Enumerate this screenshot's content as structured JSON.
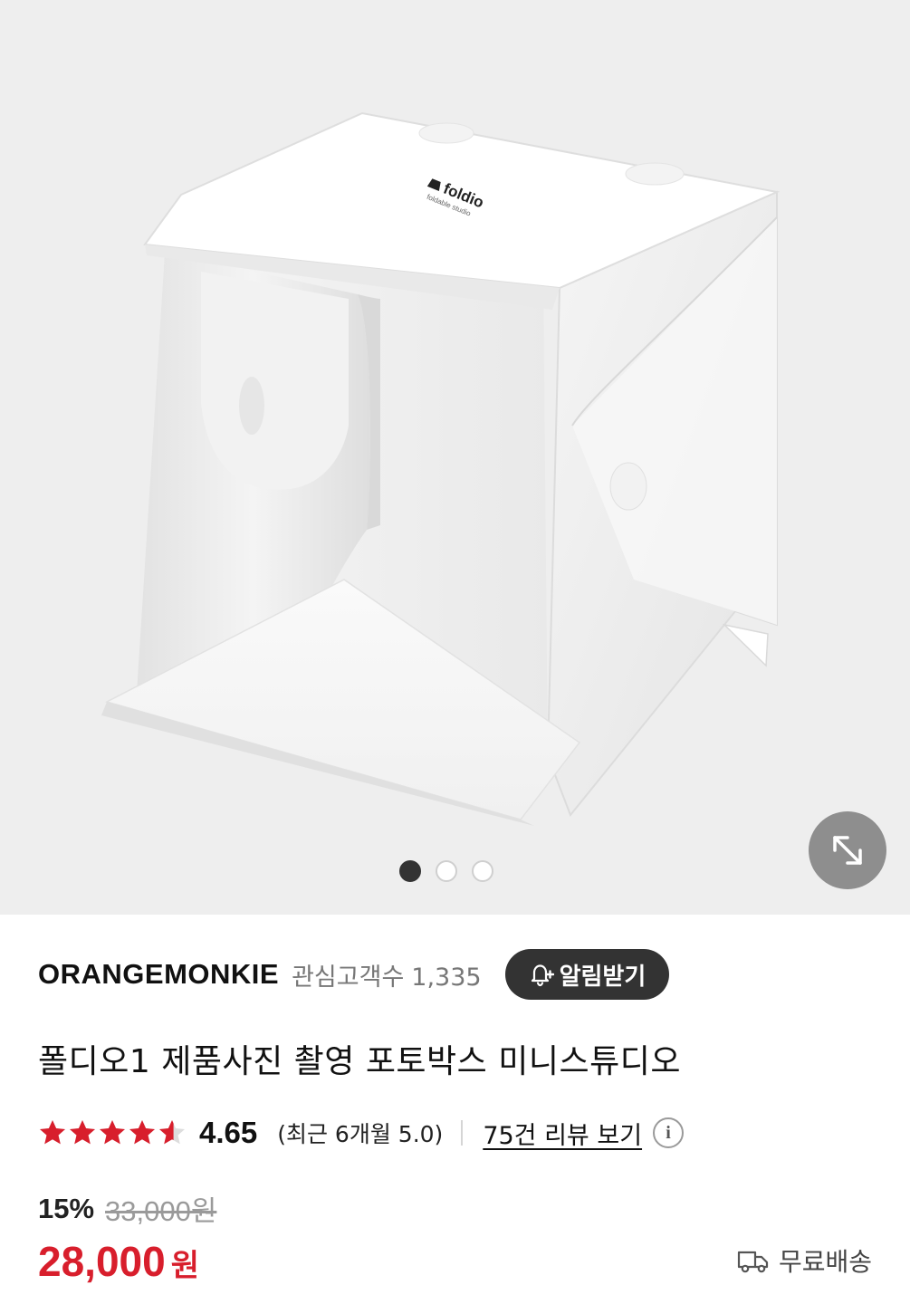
{
  "gallery": {
    "product_logo_text": "foldio",
    "product_logo_sub": "foldable studio",
    "pages": [
      {
        "active": true
      },
      {
        "active": false
      },
      {
        "active": false
      }
    ],
    "expand_icon": "diagonal-expand-arrows-icon"
  },
  "brand": {
    "name": "ORANGEMONKIE",
    "followers_label": "관심고객수",
    "followers_count": "1,335",
    "alarm_label": "알림받기",
    "alarm_icon": "bell-plus-icon"
  },
  "product": {
    "title": "폴디오1 제품사진 촬영 포토박스 미니스튜디오"
  },
  "rating": {
    "stars_value": 4.65,
    "stars_max": 5,
    "score": "4.65",
    "recent": "(최근 6개월 5.0)",
    "review_link": "75건 리뷰 보기",
    "info_icon": "info-circle-icon",
    "star_color": "#d81e2c"
  },
  "price": {
    "discount": "15%",
    "original": "33,000원",
    "current": "28,000",
    "currency": "원",
    "accent_color": "#d81e2c"
  },
  "shipping": {
    "label": "무료배송",
    "icon": "delivery-truck-icon"
  }
}
